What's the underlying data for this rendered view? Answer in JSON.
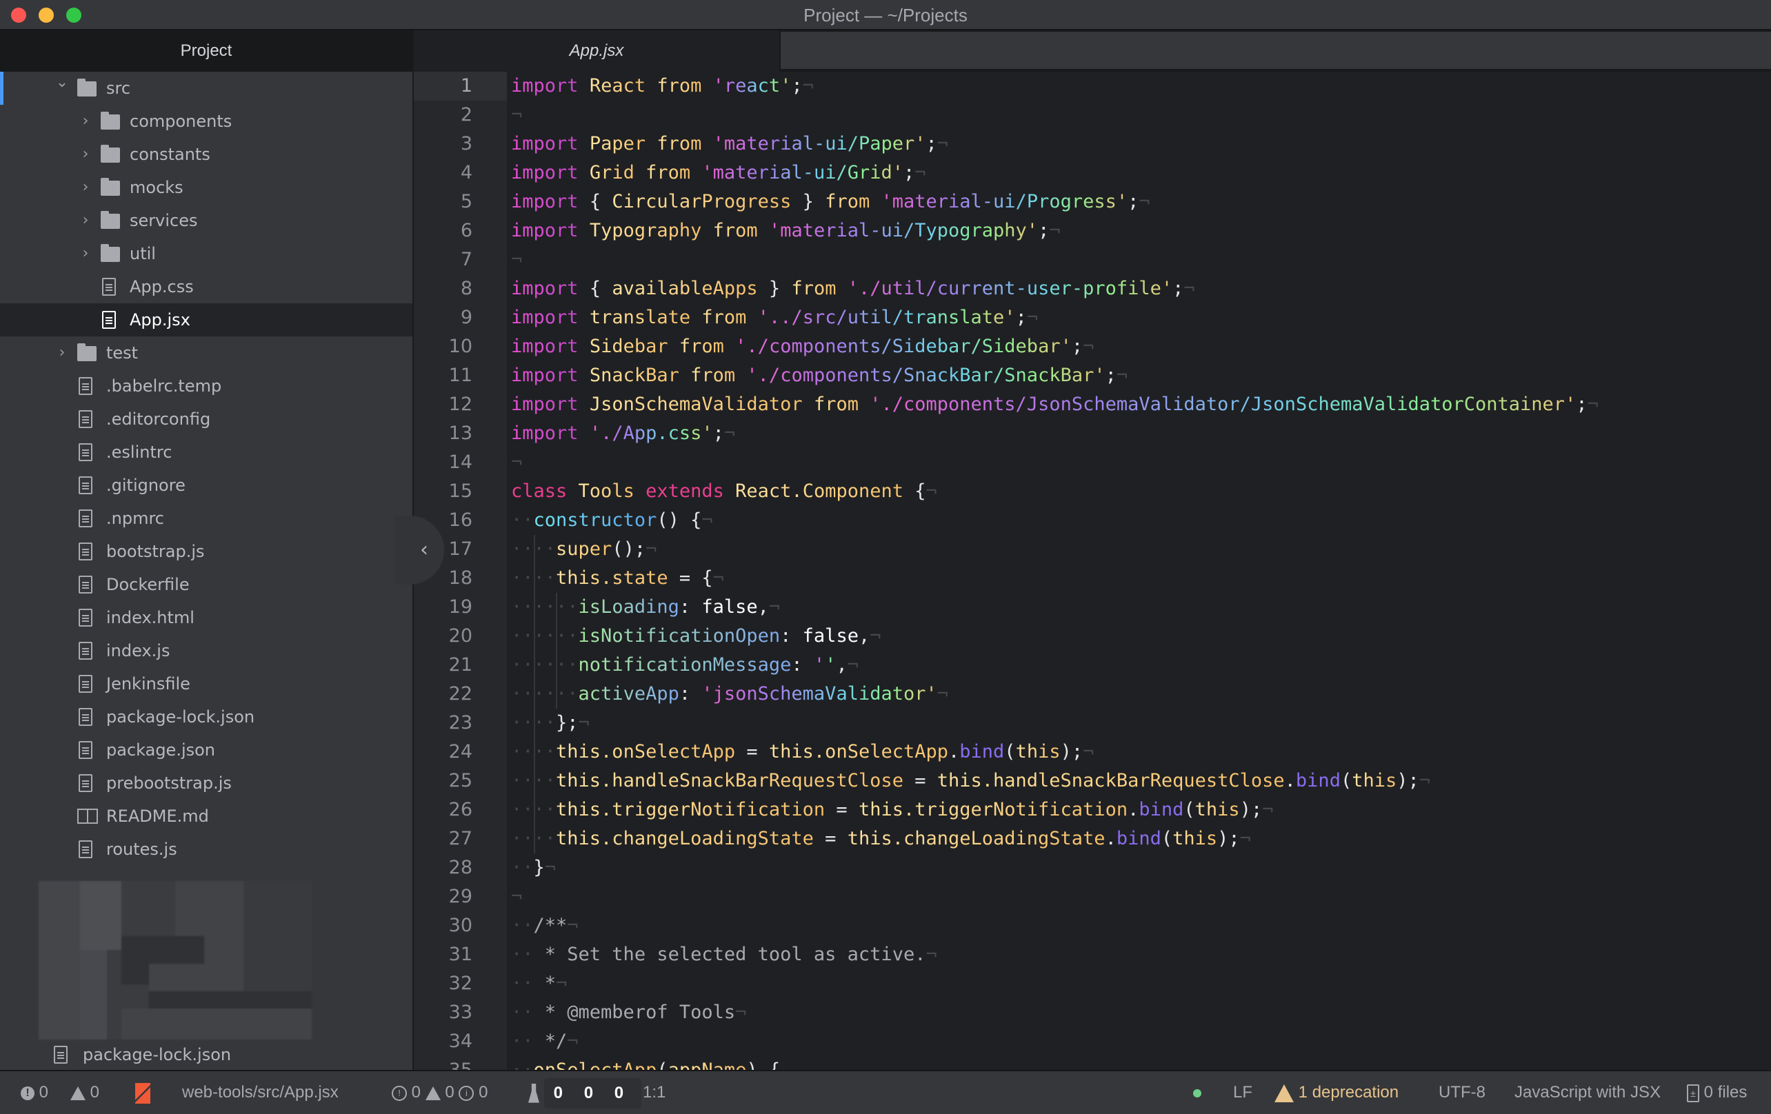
{
  "window": {
    "title": "Project — ~/Projects",
    "traffic_lights": {
      "close": "#fc5753",
      "minimize": "#fdbc40",
      "maximize": "#33c748"
    }
  },
  "sidebar": {
    "header": "Project",
    "tree": [
      {
        "label": "src",
        "type": "folder",
        "expanded": true,
        "depth": 0,
        "focused": true
      },
      {
        "label": "components",
        "type": "folder",
        "expanded": false,
        "depth": 1
      },
      {
        "label": "constants",
        "type": "folder",
        "expanded": false,
        "depth": 1
      },
      {
        "label": "mocks",
        "type": "folder",
        "expanded": false,
        "depth": 1
      },
      {
        "label": "services",
        "type": "folder",
        "expanded": false,
        "depth": 1
      },
      {
        "label": "util",
        "type": "folder",
        "expanded": false,
        "depth": 1
      },
      {
        "label": "App.css",
        "type": "file",
        "depth": 1
      },
      {
        "label": "App.jsx",
        "type": "file",
        "depth": 1,
        "selected": true
      },
      {
        "label": "test",
        "type": "folder",
        "expanded": false,
        "depth": 0
      },
      {
        "label": ".babelrc.temp",
        "type": "file",
        "depth": 0
      },
      {
        "label": ".editorconfig",
        "type": "file",
        "depth": 0
      },
      {
        "label": ".eslintrc",
        "type": "file",
        "depth": 0
      },
      {
        "label": ".gitignore",
        "type": "file",
        "depth": 0
      },
      {
        "label": ".npmrc",
        "type": "file",
        "depth": 0
      },
      {
        "label": "bootstrap.js",
        "type": "file",
        "depth": 0
      },
      {
        "label": "Dockerfile",
        "type": "file",
        "depth": 0
      },
      {
        "label": "index.html",
        "type": "file",
        "depth": 0
      },
      {
        "label": "index.js",
        "type": "file",
        "depth": 0
      },
      {
        "label": "Jenkinsfile",
        "type": "file",
        "depth": 0
      },
      {
        "label": "package-lock.json",
        "type": "file",
        "depth": 0
      },
      {
        "label": "package.json",
        "type": "file",
        "depth": 0
      },
      {
        "label": "prebootstrap.js",
        "type": "file",
        "depth": 0
      },
      {
        "label": "README.md",
        "type": "book",
        "depth": 0
      },
      {
        "label": "routes.js",
        "type": "file",
        "depth": 0
      }
    ],
    "bottom_file": "package-lock.json",
    "toggle_icon": "chevron-left-icon"
  },
  "tabs": [
    {
      "label": "App.jsx",
      "active": true
    }
  ],
  "editor": {
    "current_line": 1,
    "lines": [
      {
        "n": 1,
        "indent": 0,
        "tokens": [
          [
            "import",
            "kw"
          ],
          [
            " ",
            "ws"
          ],
          [
            "React",
            "id"
          ],
          [
            " ",
            "ws"
          ],
          [
            "from",
            "id"
          ],
          [
            " ",
            "ws"
          ],
          [
            "'react'",
            "str"
          ],
          [
            ";",
            "punc"
          ]
        ]
      },
      {
        "n": 2,
        "indent": 0,
        "tokens": []
      },
      {
        "n": 3,
        "indent": 0,
        "tokens": [
          [
            "import",
            "kw"
          ],
          [
            " ",
            "ws"
          ],
          [
            "Paper",
            "id"
          ],
          [
            " ",
            "ws"
          ],
          [
            "from",
            "id"
          ],
          [
            " ",
            "ws"
          ],
          [
            "'material-ui/Paper'",
            "str"
          ],
          [
            ";",
            "punc"
          ]
        ]
      },
      {
        "n": 4,
        "indent": 0,
        "tokens": [
          [
            "import",
            "kw"
          ],
          [
            " ",
            "ws"
          ],
          [
            "Grid",
            "id"
          ],
          [
            " ",
            "ws"
          ],
          [
            "from",
            "id"
          ],
          [
            " ",
            "ws"
          ],
          [
            "'material-ui/Grid'",
            "str"
          ],
          [
            ";",
            "punc"
          ]
        ]
      },
      {
        "n": 5,
        "indent": 0,
        "tokens": [
          [
            "import",
            "kw"
          ],
          [
            " ",
            "ws"
          ],
          [
            "{ ",
            "punc"
          ],
          [
            "CircularProgress",
            "id"
          ],
          [
            " }",
            "punc"
          ],
          [
            " ",
            "ws"
          ],
          [
            "from",
            "id"
          ],
          [
            " ",
            "ws"
          ],
          [
            "'material-ui/Progress'",
            "str"
          ],
          [
            ";",
            "punc"
          ]
        ]
      },
      {
        "n": 6,
        "indent": 0,
        "tokens": [
          [
            "import",
            "kw"
          ],
          [
            " ",
            "ws"
          ],
          [
            "Typography",
            "id"
          ],
          [
            " ",
            "ws"
          ],
          [
            "from",
            "id"
          ],
          [
            " ",
            "ws"
          ],
          [
            "'material-ui/Typography'",
            "str"
          ],
          [
            ";",
            "punc"
          ]
        ]
      },
      {
        "n": 7,
        "indent": 0,
        "tokens": []
      },
      {
        "n": 8,
        "indent": 0,
        "tokens": [
          [
            "import",
            "kw"
          ],
          [
            " ",
            "ws"
          ],
          [
            "{ ",
            "punc"
          ],
          [
            "availableApps",
            "id"
          ],
          [
            " }",
            "punc"
          ],
          [
            " ",
            "ws"
          ],
          [
            "from",
            "id"
          ],
          [
            " ",
            "ws"
          ],
          [
            "'./util/current-user-profile'",
            "str"
          ],
          [
            ";",
            "punc"
          ]
        ]
      },
      {
        "n": 9,
        "indent": 0,
        "tokens": [
          [
            "import",
            "kw"
          ],
          [
            " ",
            "ws"
          ],
          [
            "translate",
            "id"
          ],
          [
            " ",
            "ws"
          ],
          [
            "from",
            "id"
          ],
          [
            " ",
            "ws"
          ],
          [
            "'../src/util/translate'",
            "str"
          ],
          [
            ";",
            "punc"
          ]
        ]
      },
      {
        "n": 10,
        "indent": 0,
        "tokens": [
          [
            "import",
            "kw"
          ],
          [
            " ",
            "ws"
          ],
          [
            "Sidebar",
            "id"
          ],
          [
            " ",
            "ws"
          ],
          [
            "from",
            "id"
          ],
          [
            " ",
            "ws"
          ],
          [
            "'./components/Sidebar/Sidebar'",
            "str"
          ],
          [
            ";",
            "punc"
          ]
        ]
      },
      {
        "n": 11,
        "indent": 0,
        "tokens": [
          [
            "import",
            "kw"
          ],
          [
            " ",
            "ws"
          ],
          [
            "SnackBar",
            "id"
          ],
          [
            " ",
            "ws"
          ],
          [
            "from",
            "id"
          ],
          [
            " ",
            "ws"
          ],
          [
            "'./components/SnackBar/SnackBar'",
            "str"
          ],
          [
            ";",
            "punc"
          ]
        ]
      },
      {
        "n": 12,
        "indent": 0,
        "tokens": [
          [
            "import",
            "kw"
          ],
          [
            " ",
            "ws"
          ],
          [
            "JsonSchemaValidator",
            "id"
          ],
          [
            " ",
            "ws"
          ],
          [
            "from",
            "id"
          ],
          [
            " ",
            "ws"
          ],
          [
            "'./components/JsonSchemaValidator/JsonSchemaValidatorContainer'",
            "str"
          ],
          [
            ";",
            "punc"
          ]
        ]
      },
      {
        "n": 13,
        "indent": 0,
        "tokens": [
          [
            "import",
            "kw"
          ],
          [
            " ",
            "ws"
          ],
          [
            "'./App.css'",
            "str"
          ],
          [
            ";",
            "punc"
          ]
        ]
      },
      {
        "n": 14,
        "indent": 0,
        "tokens": []
      },
      {
        "n": 15,
        "indent": 0,
        "tokens": [
          [
            "class",
            "kw2"
          ],
          [
            " ",
            "ws"
          ],
          [
            "Tools",
            "id"
          ],
          [
            " ",
            "ws"
          ],
          [
            "extends",
            "kw2"
          ],
          [
            " ",
            "ws"
          ],
          [
            "React.Component",
            "id"
          ],
          [
            " {",
            "punc"
          ]
        ]
      },
      {
        "n": 16,
        "indent": 1,
        "tokens": [
          [
            "constructor",
            "fn"
          ],
          [
            "() {",
            "punc"
          ]
        ]
      },
      {
        "n": 17,
        "indent": 2,
        "tokens": [
          [
            "super",
            "id"
          ],
          [
            "();",
            "punc"
          ]
        ]
      },
      {
        "n": 18,
        "indent": 2,
        "tokens": [
          [
            "this.state",
            "id"
          ],
          [
            " = {",
            "punc"
          ]
        ]
      },
      {
        "n": 19,
        "indent": 3,
        "tokens": [
          [
            "isLoading",
            "prop"
          ],
          [
            ": ",
            "punc"
          ],
          [
            "false",
            "plain"
          ],
          [
            ",",
            "punc"
          ]
        ]
      },
      {
        "n": 20,
        "indent": 3,
        "tokens": [
          [
            "isNotificationOpen",
            "prop"
          ],
          [
            ": ",
            "punc"
          ],
          [
            "false",
            "plain"
          ],
          [
            ",",
            "punc"
          ]
        ]
      },
      {
        "n": 21,
        "indent": 3,
        "tokens": [
          [
            "notificationMessage",
            "prop"
          ],
          [
            ": ",
            "punc"
          ],
          [
            "''",
            "str"
          ],
          [
            ",",
            "punc"
          ]
        ]
      },
      {
        "n": 22,
        "indent": 3,
        "tokens": [
          [
            "activeApp",
            "prop"
          ],
          [
            ": ",
            "punc"
          ],
          [
            "'jsonSchemaValidator'",
            "str"
          ]
        ]
      },
      {
        "n": 23,
        "indent": 2,
        "tokens": [
          [
            "};",
            "punc"
          ]
        ]
      },
      {
        "n": 24,
        "indent": 2,
        "tokens": [
          [
            "this.onSelectApp",
            "id"
          ],
          [
            " = ",
            "punc"
          ],
          [
            "this.onSelectApp",
            "id"
          ],
          [
            ".",
            "punc"
          ],
          [
            "bind",
            "bind"
          ],
          [
            "(",
            "punc"
          ],
          [
            "this",
            "id"
          ],
          [
            ");",
            "punc"
          ]
        ]
      },
      {
        "n": 25,
        "indent": 2,
        "tokens": [
          [
            "this.handleSnackBarRequestClose",
            "id"
          ],
          [
            " = ",
            "punc"
          ],
          [
            "this.handleSnackBarRequestClose",
            "id"
          ],
          [
            ".",
            "punc"
          ],
          [
            "bind",
            "bind"
          ],
          [
            "(",
            "punc"
          ],
          [
            "this",
            "id"
          ],
          [
            ");",
            "punc"
          ]
        ]
      },
      {
        "n": 26,
        "indent": 2,
        "tokens": [
          [
            "this.triggerNotification",
            "id"
          ],
          [
            " = ",
            "punc"
          ],
          [
            "this.triggerNotification",
            "id"
          ],
          [
            ".",
            "punc"
          ],
          [
            "bind",
            "bind"
          ],
          [
            "(",
            "punc"
          ],
          [
            "this",
            "id"
          ],
          [
            ");",
            "punc"
          ]
        ]
      },
      {
        "n": 27,
        "indent": 2,
        "tokens": [
          [
            "this.changeLoadingState",
            "id"
          ],
          [
            " = ",
            "punc"
          ],
          [
            "this.changeLoadingState",
            "id"
          ],
          [
            ".",
            "punc"
          ],
          [
            "bind",
            "bind"
          ],
          [
            "(",
            "punc"
          ],
          [
            "this",
            "id"
          ],
          [
            ");",
            "punc"
          ]
        ]
      },
      {
        "n": 28,
        "indent": 1,
        "tokens": [
          [
            "}",
            "punc"
          ]
        ]
      },
      {
        "n": 29,
        "indent": 0,
        "tokens": []
      },
      {
        "n": 30,
        "indent": 1,
        "tokens": [
          [
            "/**",
            "cmt"
          ]
        ]
      },
      {
        "n": 31,
        "indent": 1,
        "tokens": [
          [
            " * Set the selected tool as active.",
            "cmt"
          ]
        ]
      },
      {
        "n": 32,
        "indent": 1,
        "tokens": [
          [
            " *",
            "cmt"
          ]
        ]
      },
      {
        "n": 33,
        "indent": 1,
        "tokens": [
          [
            " * @memberof Tools",
            "cmt"
          ]
        ]
      },
      {
        "n": 34,
        "indent": 1,
        "tokens": [
          [
            " */",
            "cmt"
          ]
        ]
      },
      {
        "n": 35,
        "indent": 1,
        "tokens": [
          [
            "onSelectApp",
            "id"
          ],
          [
            "(",
            "punc"
          ],
          [
            "appName",
            "id"
          ],
          [
            ") {",
            "punc"
          ]
        ]
      }
    ]
  },
  "statusbar": {
    "lint_errors": "0",
    "lint_warnings": "0",
    "file_path": "web-tools/src/App.jsx",
    "diag_errors": "0",
    "diag_warnings": "0",
    "diag_infos": "0",
    "test_counts": "0 0 0",
    "cursor_position": "1:1",
    "line_ending": "LF",
    "deprecations": "1 deprecation",
    "encoding": "UTF-8",
    "grammar": "JavaScript with JSX",
    "changed_files": "0 files",
    "colors": {
      "deprecation": "#e7c48b",
      "git_icon": "#f05a36",
      "status_dot": "#6fcf87",
      "focus_accent": "#4a9af5"
    }
  }
}
